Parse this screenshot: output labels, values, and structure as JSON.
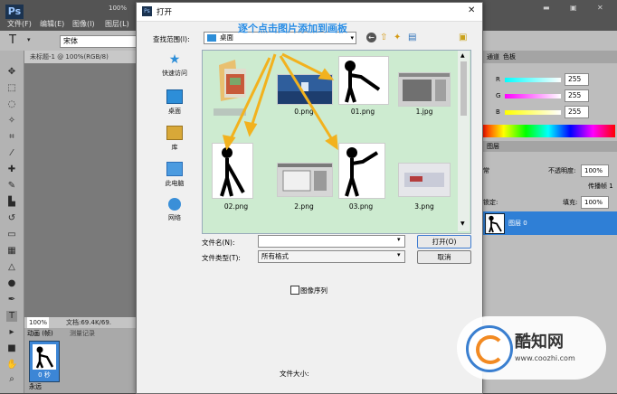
{
  "ps": {
    "logo": "Ps",
    "menus": [
      "文件(F)",
      "编辑(E)",
      "图像(I)",
      "图层(L)"
    ],
    "zoom_top": "100%",
    "font_name": "宋体",
    "doc_tab": "未标题-1 @ 100%(RGB/8)",
    "status_zoom": "100%",
    "status_doc": "文档:69.4K/69.",
    "anim_tab": "动画 (帧)",
    "history_tab": "测量记录",
    "frame_time": "0 秒",
    "loop": "永远"
  },
  "right": {
    "tabs": [
      "通道",
      "色板"
    ],
    "r": "R",
    "g": "G",
    "b": "B",
    "r_val": "255",
    "g_val": "255",
    "b_val": "255",
    "layer_tabs": [
      "图层"
    ],
    "blend": "常",
    "opacity_label": "不透明度:",
    "opacity_val": "100%",
    "lock_label": "锁定:",
    "fill_label": "填充:",
    "fill_val": "100%",
    "propagate": "传播帧 1",
    "layer_name": "图层 0"
  },
  "dialog": {
    "title": "打开",
    "lookin_label": "查找范围(I):",
    "lookin_value": "桌面",
    "annotation": "逐个点击图片添加到画板",
    "places": [
      "快速访问",
      "桌面",
      "库",
      "此电脑",
      "网络"
    ],
    "files": [
      {
        "name": ""
      },
      {
        "name": "0.png"
      },
      {
        "name": "01.png"
      },
      {
        "name": "1.jpg"
      },
      {
        "name": "02.png"
      },
      {
        "name": "2.png"
      },
      {
        "name": "03.png"
      },
      {
        "name": "3.png"
      }
    ],
    "filename_label": "文件名(N):",
    "filename_value": "",
    "filetype_label": "文件类型(T):",
    "filetype_value": "所有格式",
    "open_button": "打开(O)",
    "cancel_button": "取消",
    "image_sequence": "图像序列",
    "file_size_label": "文件大小:"
  },
  "watermark": {
    "text": "酷知网",
    "url": "www.coozhi.com"
  },
  "colors": {
    "annotation": "#2a8ee6",
    "arrow": "#f2b21e",
    "file_area": "#cdebd0",
    "layer_selected": "#2f7fd6"
  }
}
